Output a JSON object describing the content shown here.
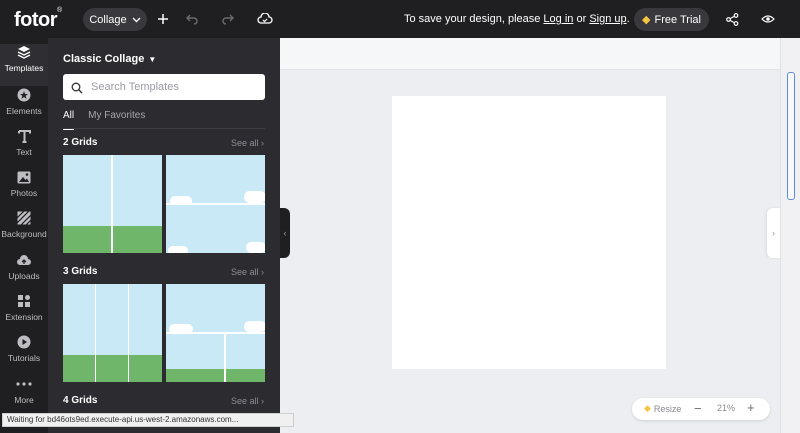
{
  "app": {
    "logo": "fotor",
    "logo_mark": "®",
    "mode_button": "Collage",
    "save_message_prefix": "To save your design, please ",
    "login_link": "Log in",
    "save_message_or": " or ",
    "signup_link": "Sign up",
    "save_message_suffix": ".",
    "free_trial": "Free Trial"
  },
  "rail": {
    "items": [
      {
        "label": "Templates",
        "icon": "templates-icon",
        "active": true
      },
      {
        "label": "Elements",
        "icon": "star-icon"
      },
      {
        "label": "Text",
        "icon": "text-icon"
      },
      {
        "label": "Photos",
        "icon": "photo-icon"
      },
      {
        "label": "Background",
        "icon": "background-icon"
      },
      {
        "label": "Uploads",
        "icon": "upload-icon"
      },
      {
        "label": "Extension",
        "icon": "extension-icon"
      },
      {
        "label": "Tutorials",
        "icon": "play-icon"
      },
      {
        "label": "More",
        "icon": "more-icon"
      }
    ]
  },
  "panel": {
    "title": "Classic Collage",
    "search_placeholder": "Search Templates",
    "tabs": [
      {
        "label": "All",
        "active": true
      },
      {
        "label": "My Favorites"
      }
    ],
    "sections": [
      {
        "title": "2 Grids",
        "see_all": "See all"
      },
      {
        "title": "3 Grids",
        "see_all": "See all"
      },
      {
        "title": "4 Grids",
        "see_all": "See all"
      }
    ]
  },
  "canvas": {
    "zoom": "21%",
    "resize_label": "Resize"
  },
  "status_bar": "Waiting for bd46ots9ed.execute-api.us-west-2.amazonaws.com...",
  "colors": {
    "topbar": "#1f1f22",
    "panel": "#2b2b30",
    "sky": "#c9e9f6",
    "grass": "#6fb56a",
    "gem": "#f5c542"
  }
}
